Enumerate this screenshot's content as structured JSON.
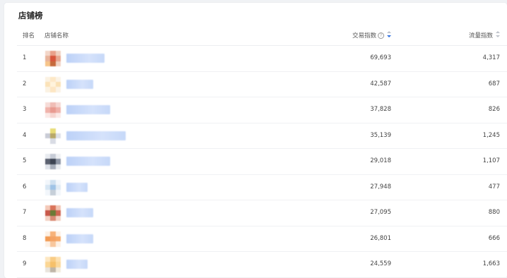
{
  "title": "店铺榜",
  "columns": {
    "rank": "排名",
    "shop": "店铺名称",
    "trade": "交易指数",
    "flow": "流量指数"
  },
  "icons": {
    "help": "question-circle-icon",
    "sort_trade": "sort-desc-icon",
    "sort_flow": "sort-icon"
  },
  "colors": {
    "accent": "#2f6fe0",
    "blur_name": "#c6d8f8"
  },
  "rows": [
    {
      "rank": "1",
      "trade": "69,693",
      "flow": "4,317",
      "logo": [
        "#f3d6c8",
        "#e9a08a",
        "#f0d0c0",
        "#e8b39a",
        "#d8553c",
        "#e7a58e",
        "#f6c58a",
        "#c66a3c",
        "#f1d2c3"
      ],
      "name_w": 54
    },
    {
      "rank": "2",
      "trade": "42,587",
      "flow": "687",
      "logo": [
        "#fbf2e2",
        "#fde8c7",
        "#fbf3e6",
        "#fbe2b8",
        "#fff3dc",
        "#fae1b5",
        "#fbf2e2",
        "#fde6c4",
        "#fbf3e6"
      ],
      "name_w": 38
    },
    {
      "rank": "3",
      "trade": "37,828",
      "flow": "826",
      "logo": [
        "#f6dcd8",
        "#f0bdb6",
        "#f5d8d4",
        "#f0b3ab",
        "#e89a90",
        "#efb1a9",
        "#fbe9e6",
        "#f6d5d0",
        "#fbe9e6"
      ],
      "name_w": 62
    },
    {
      "rank": "4",
      "trade": "35,139",
      "flow": "1,245",
      "logo": [
        "#ffffff",
        "#e8dd7a",
        "#ffffff",
        "#c9ccd6",
        "#b8a86a",
        "#dde0e8",
        "#ffffff",
        "#d9dce4",
        "#ffffff"
      ],
      "name_w": 84
    },
    {
      "rank": "5",
      "trade": "29,018",
      "flow": "1,107",
      "logo": [
        "#e8ebf0",
        "#c7ccd6",
        "#eef0f3",
        "#5c6270",
        "#3c4352",
        "#8d95a5",
        "#dfe3ea",
        "#a7aebb",
        "#e8ebf0"
      ],
      "name_w": 62
    },
    {
      "rank": "6",
      "trade": "27,948",
      "flow": "477",
      "logo": [
        "#f2f6fb",
        "#cfe0f0",
        "#f2f6fb",
        "#d7e6f3",
        "#9fc3e6",
        "#dfeaf4",
        "#f2f6fb",
        "#c6cfd9",
        "#f2f6fb"
      ],
      "name_w": 30
    },
    {
      "rank": "7",
      "trade": "27,095",
      "flow": "880",
      "logo": [
        "#f4c9b8",
        "#d9735a",
        "#f1c4b3",
        "#c8584a",
        "#6b7a35",
        "#cf6552",
        "#f4d2c4",
        "#d98a74",
        "#f4d2c4"
      ],
      "name_w": 38
    },
    {
      "rank": "8",
      "trade": "26,801",
      "flow": "666",
      "logo": [
        "#fdf0e4",
        "#f7b27a",
        "#fdf0e4",
        "#f29a52",
        "#f4a264",
        "#f6aa6a",
        "#fdf0e4",
        "#f8c79d",
        "#fdf0e4"
      ],
      "name_w": 38
    },
    {
      "rank": "9",
      "trade": "24,559",
      "flow": "1,663",
      "logo": [
        "#fde7c2",
        "#f9cc84",
        "#fde0b0",
        "#fbd694",
        "#f6c06a",
        "#fbd89a",
        "#e9e4dc",
        "#bfb6a8",
        "#f3ecde"
      ],
      "name_w": 30
    }
  ]
}
